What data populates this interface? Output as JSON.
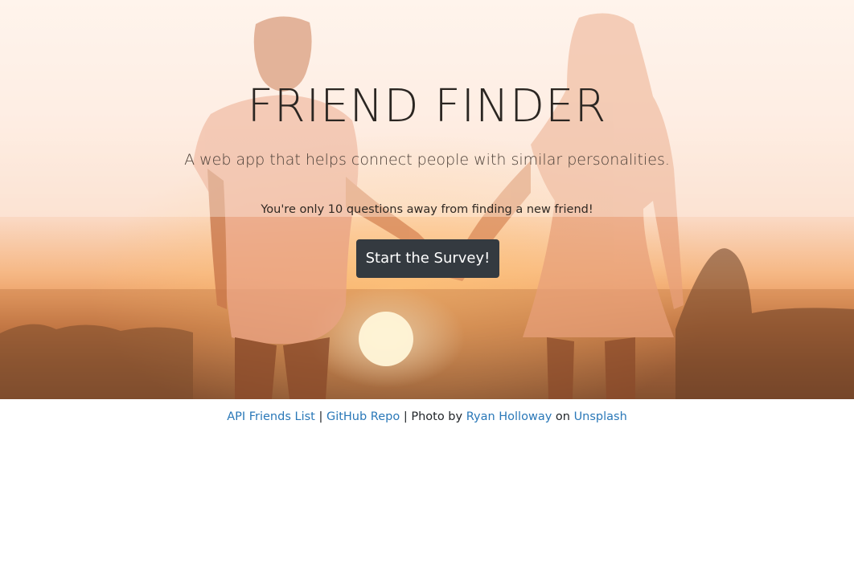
{
  "hero": {
    "title": "FRIEND FINDER",
    "subtitle": "A web app that helps connect people with similar personalities.",
    "tagline": "You're only 10 questions away from finding a new friend!",
    "button_label": "Start the Survey!",
    "background_image": "silhouette of couple holding hands at sunset"
  },
  "footer": {
    "api_link": "API Friends List",
    "sep1": " | ",
    "github_link": "GitHub Repo",
    "sep2": " | Photo by ",
    "photographer_link": "Ryan Holloway",
    "on_text": " on ",
    "unsplash_link": "Unsplash"
  },
  "colors": {
    "button_bg": "#343a40",
    "link": "#2a78b8",
    "text": "#212529"
  }
}
